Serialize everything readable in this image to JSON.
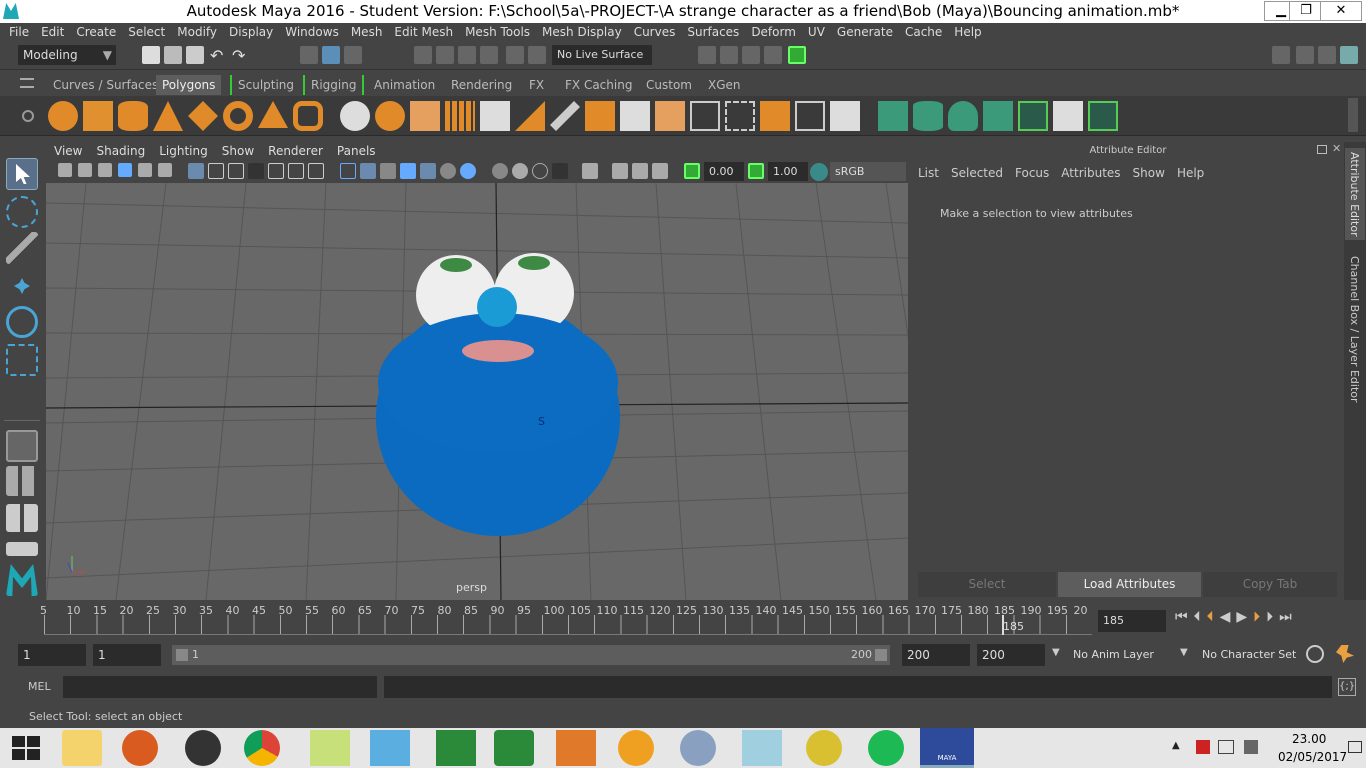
{
  "window": {
    "title": "Autodesk Maya 2016 - Student Version: F:\\School\\5a\\-PROJECT-\\A strange character as a friend\\Bob (Maya)\\Bouncing animation.mb*",
    "min": "▁",
    "max": "❐",
    "close": "✕"
  },
  "menu": [
    "File",
    "Edit",
    "Create",
    "Select",
    "Modify",
    "Display",
    "Windows",
    "Mesh",
    "Edit Mesh",
    "Mesh Tools",
    "Mesh Display",
    "Curves",
    "Surfaces",
    "Deform",
    "UV",
    "Generate",
    "Cache",
    "Help"
  ],
  "status": {
    "mode": "Modeling",
    "live_surface": "No Live Surface"
  },
  "shelf_tabs": [
    "Curves / Surfaces",
    "Polygons",
    "Sculpting",
    "Rigging",
    "Animation",
    "Rendering",
    "FX",
    "FX Caching",
    "Custom",
    "XGen"
  ],
  "viewport": {
    "menu": [
      "View",
      "Shading",
      "Lighting",
      "Show",
      "Renderer",
      "Panels"
    ],
    "exposure": "0.00",
    "gamma": "1.00",
    "colorspace": "sRGB gamma",
    "camera": "persp",
    "marker": "S"
  },
  "attr": {
    "title": "Attribute Editor",
    "menu": [
      "List",
      "Selected",
      "Focus",
      "Attributes",
      "Show",
      "Help"
    ],
    "message": "Make a selection to view attributes",
    "buttons": {
      "select": "Select",
      "load": "Load Attributes",
      "copy": "Copy Tab"
    }
  },
  "side_tabs": {
    "attribute_editor": "Attribute Editor",
    "channel_box": "Channel Box / Layer Editor"
  },
  "timeline": {
    "ticks": [
      "5",
      "10",
      "15",
      "20",
      "25",
      "30",
      "35",
      "40",
      "45",
      "50",
      "55",
      "60",
      "65",
      "70",
      "75",
      "80",
      "85",
      "90",
      "95",
      "100",
      "105",
      "110",
      "115",
      "120",
      "125",
      "130",
      "135",
      "140",
      "145",
      "150",
      "155",
      "160",
      "165",
      "170",
      "175",
      "180",
      "185",
      "190",
      "195",
      "20"
    ],
    "current": "185",
    "current_field": "185"
  },
  "range": {
    "start": "1",
    "start2": "1",
    "slider_start": "1",
    "slider_end": "200",
    "end": "200",
    "end2": "200",
    "anim_layer": "No Anim Layer",
    "char_set": "No Character Set"
  },
  "cmd": {
    "label": "MEL"
  },
  "help": {
    "text": "Select Tool: select an object"
  },
  "taskbar": {
    "time": "23.00",
    "date": "02/05/2017",
    "maya_label": "MAYA"
  }
}
